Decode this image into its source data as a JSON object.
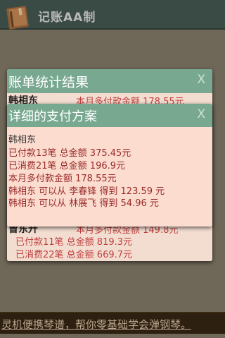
{
  "app": {
    "title": "记账AA制"
  },
  "dialog_summary": {
    "title": "账单统计结果",
    "close": "X",
    "rows": [
      {
        "name": "韩相东",
        "value": "本月多付款金额 178.55元"
      }
    ],
    "bottom": {
      "name": "曾东升",
      "value": "本月多付款金额 149.8元",
      "paid": "已付款11笔  总金额 819.3元",
      "consumed": "已消费22笔  总金额 669.7元"
    }
  },
  "dialog_plan": {
    "title": "详细的支付方案",
    "close": "X",
    "person": "韩相东",
    "lines": [
      "已付款13笔  总金额 375.45元",
      "已消费21笔  总金额 196.9元",
      "本月多付款金额 178.55元",
      "韩相东 可以从 李春锋 得到 123.59 元",
      "韩相东 可以从 林展飞 得到 54.96 元"
    ]
  },
  "banner": {
    "text": "灵机便携琴谱，帮你零基础学会弹钢琴。"
  }
}
